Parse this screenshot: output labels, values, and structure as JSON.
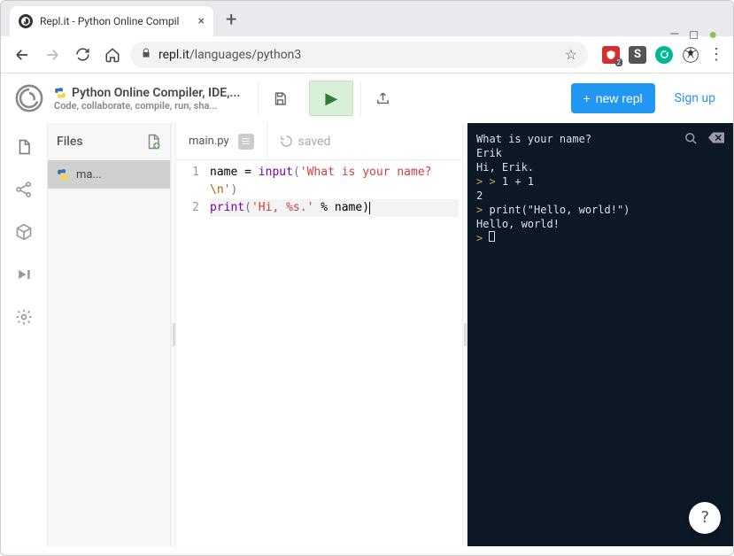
{
  "browser": {
    "tab_title": "Repl.it - Python Online Compil",
    "url_prefix": "repl.it",
    "url_path": "/languages/python3",
    "ext_badge": "2",
    "ext_s": "S"
  },
  "header": {
    "subtitle": "Code, collaborate, compile, run, sha...",
    "title": "Python Online Compiler, IDE,...",
    "new_repl_label": "new repl",
    "signup_label": "Sign up"
  },
  "files": {
    "header": "Files",
    "items": [
      "ma..."
    ]
  },
  "editor": {
    "tab_name": "main.py",
    "saved_label": "saved",
    "lines": {
      "n1": "1",
      "n2": "2"
    },
    "code": {
      "l1a": "name = ",
      "l1b": "input",
      "l1c": "(",
      "l1d": "'What is your name?",
      "l1e": "\\n",
      "l1f": "'",
      "l1g": ")",
      "l2a": "print",
      "l2b": "(",
      "l2c": "'Hi, %s.'",
      "l2d": " % name)"
    }
  },
  "console": {
    "lines": {
      "l1": "What is your name?",
      "l2": "Erik",
      "l3": "Hi, Erik.",
      "l4": " 1 + 1",
      "l5": "2",
      "l6": " print(\"Hello, world!\")",
      "l7": "Hello, world!"
    }
  },
  "help": {
    "label": "?"
  }
}
